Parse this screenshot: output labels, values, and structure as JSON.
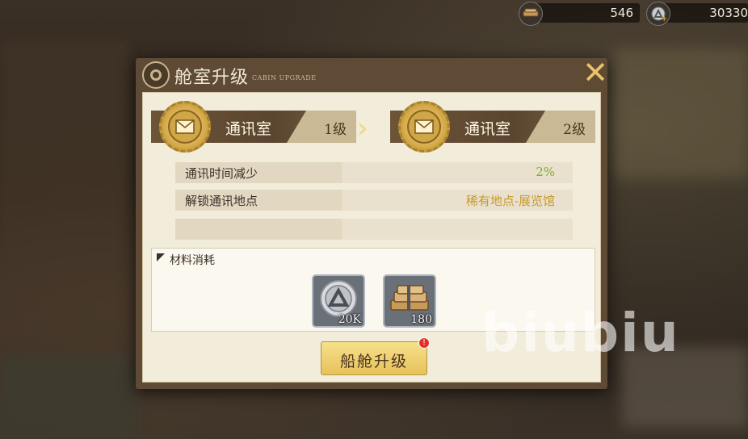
{
  "resources": {
    "wood": {
      "icon": "wood-planks-icon",
      "value": "546"
    },
    "coin": {
      "icon": "silver-coin-icon",
      "value": "30330"
    }
  },
  "dialog": {
    "title": "舱室升级",
    "subtitle": "CABIN UPGRADE",
    "close_icon": "close-x-icon"
  },
  "upgrade": {
    "from": {
      "name": "通讯室",
      "level": "1级",
      "icon": "envelope-icon"
    },
    "to": {
      "name": "通讯室",
      "level": "2级",
      "icon": "envelope-icon"
    },
    "arrow": "›"
  },
  "stats": [
    {
      "label": "通讯时间减少",
      "value": "2%"
    },
    {
      "label": "解锁通讯地点",
      "value": "稀有地点-展览馆"
    },
    {
      "label": "",
      "value": ""
    }
  ],
  "materials": {
    "title": "材料消耗",
    "items": [
      {
        "icon": "silver-coin-icon",
        "qty": "20K"
      },
      {
        "icon": "wood-planks-icon",
        "qty": "180"
      }
    ]
  },
  "button": {
    "label": "船舱升级",
    "alert": "!"
  },
  "watermark": "biubiu",
  "colors": {
    "accent_gold": "#e7c46a",
    "value_green": "#7ab02a",
    "value_gold": "#c89a2a"
  }
}
